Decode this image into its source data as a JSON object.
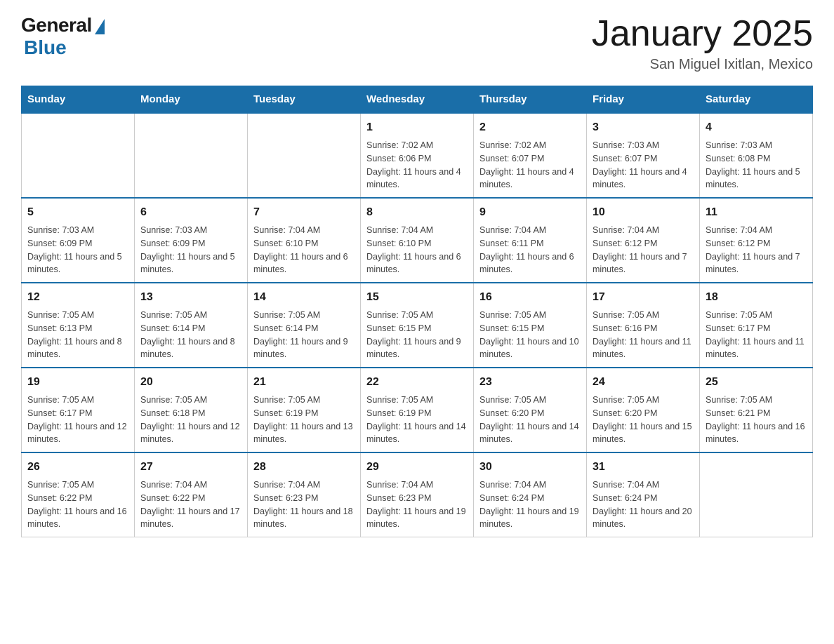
{
  "header": {
    "logo_general": "General",
    "logo_blue": "Blue",
    "month_title": "January 2025",
    "location": "San Miguel Ixitlan, Mexico"
  },
  "days_of_week": [
    "Sunday",
    "Monday",
    "Tuesday",
    "Wednesday",
    "Thursday",
    "Friday",
    "Saturday"
  ],
  "weeks": [
    [
      {
        "day": "",
        "info": ""
      },
      {
        "day": "",
        "info": ""
      },
      {
        "day": "",
        "info": ""
      },
      {
        "day": "1",
        "info": "Sunrise: 7:02 AM\nSunset: 6:06 PM\nDaylight: 11 hours and 4 minutes."
      },
      {
        "day": "2",
        "info": "Sunrise: 7:02 AM\nSunset: 6:07 PM\nDaylight: 11 hours and 4 minutes."
      },
      {
        "day": "3",
        "info": "Sunrise: 7:03 AM\nSunset: 6:07 PM\nDaylight: 11 hours and 4 minutes."
      },
      {
        "day": "4",
        "info": "Sunrise: 7:03 AM\nSunset: 6:08 PM\nDaylight: 11 hours and 5 minutes."
      }
    ],
    [
      {
        "day": "5",
        "info": "Sunrise: 7:03 AM\nSunset: 6:09 PM\nDaylight: 11 hours and 5 minutes."
      },
      {
        "day": "6",
        "info": "Sunrise: 7:03 AM\nSunset: 6:09 PM\nDaylight: 11 hours and 5 minutes."
      },
      {
        "day": "7",
        "info": "Sunrise: 7:04 AM\nSunset: 6:10 PM\nDaylight: 11 hours and 6 minutes."
      },
      {
        "day": "8",
        "info": "Sunrise: 7:04 AM\nSunset: 6:10 PM\nDaylight: 11 hours and 6 minutes."
      },
      {
        "day": "9",
        "info": "Sunrise: 7:04 AM\nSunset: 6:11 PM\nDaylight: 11 hours and 6 minutes."
      },
      {
        "day": "10",
        "info": "Sunrise: 7:04 AM\nSunset: 6:12 PM\nDaylight: 11 hours and 7 minutes."
      },
      {
        "day": "11",
        "info": "Sunrise: 7:04 AM\nSunset: 6:12 PM\nDaylight: 11 hours and 7 minutes."
      }
    ],
    [
      {
        "day": "12",
        "info": "Sunrise: 7:05 AM\nSunset: 6:13 PM\nDaylight: 11 hours and 8 minutes."
      },
      {
        "day": "13",
        "info": "Sunrise: 7:05 AM\nSunset: 6:14 PM\nDaylight: 11 hours and 8 minutes."
      },
      {
        "day": "14",
        "info": "Sunrise: 7:05 AM\nSunset: 6:14 PM\nDaylight: 11 hours and 9 minutes."
      },
      {
        "day": "15",
        "info": "Sunrise: 7:05 AM\nSunset: 6:15 PM\nDaylight: 11 hours and 9 minutes."
      },
      {
        "day": "16",
        "info": "Sunrise: 7:05 AM\nSunset: 6:15 PM\nDaylight: 11 hours and 10 minutes."
      },
      {
        "day": "17",
        "info": "Sunrise: 7:05 AM\nSunset: 6:16 PM\nDaylight: 11 hours and 11 minutes."
      },
      {
        "day": "18",
        "info": "Sunrise: 7:05 AM\nSunset: 6:17 PM\nDaylight: 11 hours and 11 minutes."
      }
    ],
    [
      {
        "day": "19",
        "info": "Sunrise: 7:05 AM\nSunset: 6:17 PM\nDaylight: 11 hours and 12 minutes."
      },
      {
        "day": "20",
        "info": "Sunrise: 7:05 AM\nSunset: 6:18 PM\nDaylight: 11 hours and 12 minutes."
      },
      {
        "day": "21",
        "info": "Sunrise: 7:05 AM\nSunset: 6:19 PM\nDaylight: 11 hours and 13 minutes."
      },
      {
        "day": "22",
        "info": "Sunrise: 7:05 AM\nSunset: 6:19 PM\nDaylight: 11 hours and 14 minutes."
      },
      {
        "day": "23",
        "info": "Sunrise: 7:05 AM\nSunset: 6:20 PM\nDaylight: 11 hours and 14 minutes."
      },
      {
        "day": "24",
        "info": "Sunrise: 7:05 AM\nSunset: 6:20 PM\nDaylight: 11 hours and 15 minutes."
      },
      {
        "day": "25",
        "info": "Sunrise: 7:05 AM\nSunset: 6:21 PM\nDaylight: 11 hours and 16 minutes."
      }
    ],
    [
      {
        "day": "26",
        "info": "Sunrise: 7:05 AM\nSunset: 6:22 PM\nDaylight: 11 hours and 16 minutes."
      },
      {
        "day": "27",
        "info": "Sunrise: 7:04 AM\nSunset: 6:22 PM\nDaylight: 11 hours and 17 minutes."
      },
      {
        "day": "28",
        "info": "Sunrise: 7:04 AM\nSunset: 6:23 PM\nDaylight: 11 hours and 18 minutes."
      },
      {
        "day": "29",
        "info": "Sunrise: 7:04 AM\nSunset: 6:23 PM\nDaylight: 11 hours and 19 minutes."
      },
      {
        "day": "30",
        "info": "Sunrise: 7:04 AM\nSunset: 6:24 PM\nDaylight: 11 hours and 19 minutes."
      },
      {
        "day": "31",
        "info": "Sunrise: 7:04 AM\nSunset: 6:24 PM\nDaylight: 11 hours and 20 minutes."
      },
      {
        "day": "",
        "info": ""
      }
    ]
  ]
}
